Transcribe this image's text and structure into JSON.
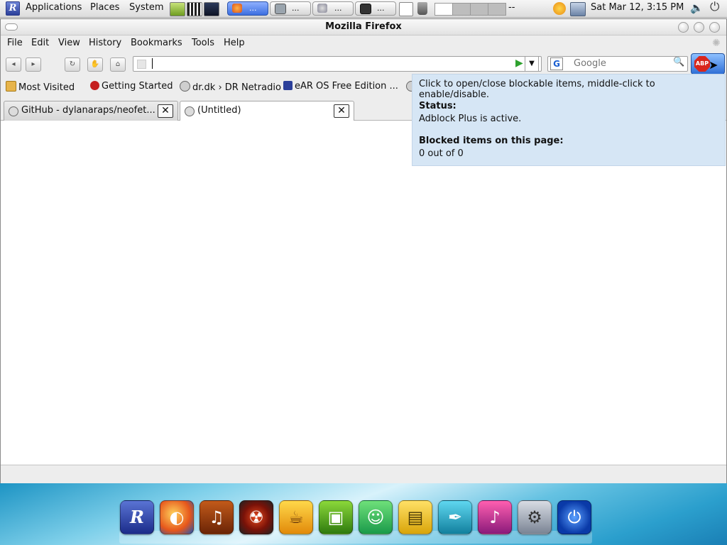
{
  "top_panel": {
    "menus": [
      "Applications",
      "Places",
      "System"
    ],
    "taskbar_labels": [
      "...",
      "...",
      "...",
      "..."
    ],
    "workspace_overflow": "--",
    "clock": "Sat Mar 12,  3:15 PM"
  },
  "firefox": {
    "title": "Mozilla Firefox",
    "menu": {
      "file": "File",
      "edit": "Edit",
      "view": "View",
      "history": "History",
      "bookmarks": "Bookmarks",
      "tools": "Tools",
      "help": "Help"
    },
    "url_value": "",
    "search_placeholder": "Google",
    "abp_label": "ABP",
    "bookmarks": [
      "Most Visited",
      "Getting Started",
      "dr.dk › DR Netradio",
      "eAR OS Free Edition ..."
    ],
    "tabs": [
      {
        "label": "GitHub - dylanaraps/neofet...",
        "close": "✕"
      },
      {
        "label": "(Untitled)",
        "close": "✕"
      }
    ]
  },
  "tooltip": {
    "hint": "Click to open/close blockable items, middle-click to enable/disable.",
    "status_heading": "Status:",
    "status_text": "Adblock Plus is active.",
    "blocked_heading": "Blocked items on this page:",
    "blocked_text": "0 out of 0"
  },
  "dock": {
    "icons": [
      "eAR OS",
      "Firefox",
      "GarageBand",
      "Burner",
      "Java",
      "Image Viewer",
      "Messenger",
      "Office",
      "Write",
      "iTunes",
      "System Preferences",
      "Shut Down"
    ]
  },
  "colors": {
    "tooltip_bg": "#d6e6f5",
    "abp_red": "#d9261c",
    "accent_blue": "#3d6fe0"
  }
}
